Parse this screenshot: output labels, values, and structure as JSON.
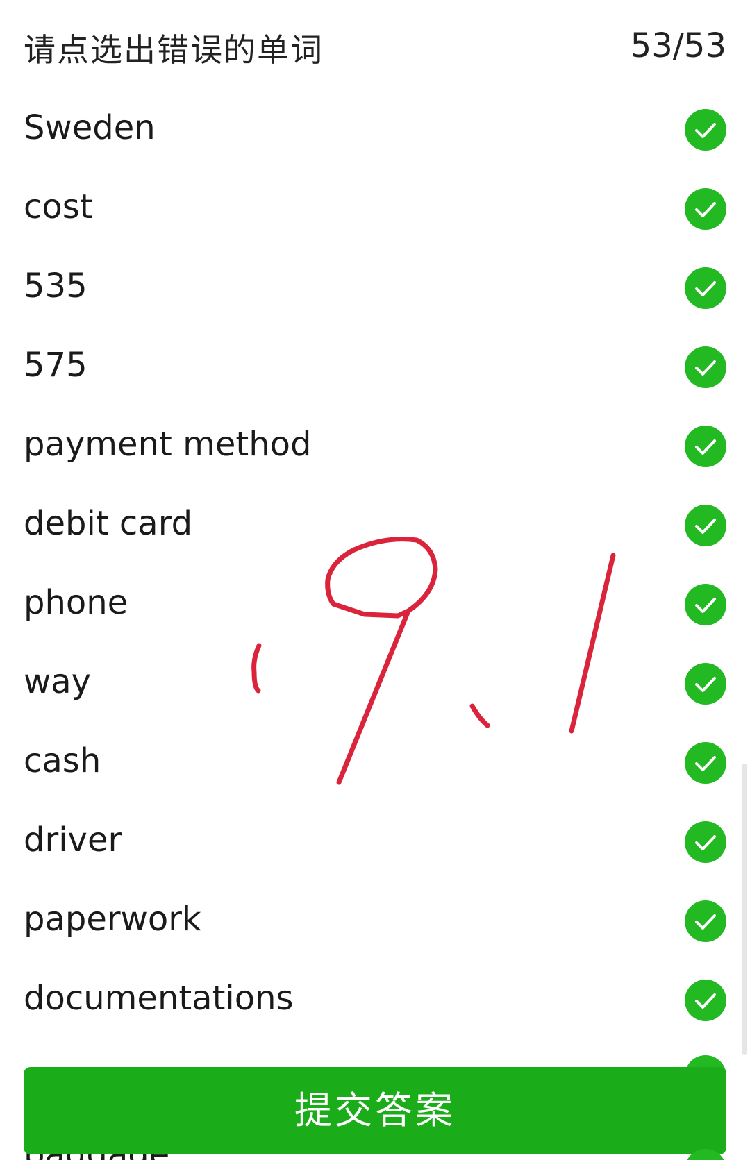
{
  "header": {
    "title": "请点选出错误的单词",
    "progress": "53/53"
  },
  "words": [
    {
      "text": "Sweden",
      "status_icon": "check-circle-icon"
    },
    {
      "text": "cost",
      "status_icon": "check-circle-icon"
    },
    {
      "text": "535",
      "status_icon": "check-circle-icon"
    },
    {
      "text": "575",
      "status_icon": "check-circle-icon"
    },
    {
      "text": "payment method",
      "status_icon": "check-circle-icon"
    },
    {
      "text": "debit card",
      "status_icon": "check-circle-icon"
    },
    {
      "text": "phone",
      "status_icon": "check-circle-icon"
    },
    {
      "text": "way",
      "status_icon": "check-circle-icon"
    },
    {
      "text": "cash",
      "status_icon": "check-circle-icon"
    },
    {
      "text": "driver",
      "status_icon": "check-circle-icon"
    },
    {
      "text": "paperwork",
      "status_icon": "check-circle-icon"
    },
    {
      "text": "documentations",
      "status_icon": "check-circle-icon"
    }
  ],
  "partially_visible_word": "baggage",
  "submit_button": {
    "label": "提交答案"
  },
  "annotation": {
    "handwritten_text": "'9.1"
  },
  "colors": {
    "check_green": "#22b922",
    "button_green": "#1aad19",
    "scribble_red": "#d9243c",
    "text": "#1a1a1a"
  }
}
